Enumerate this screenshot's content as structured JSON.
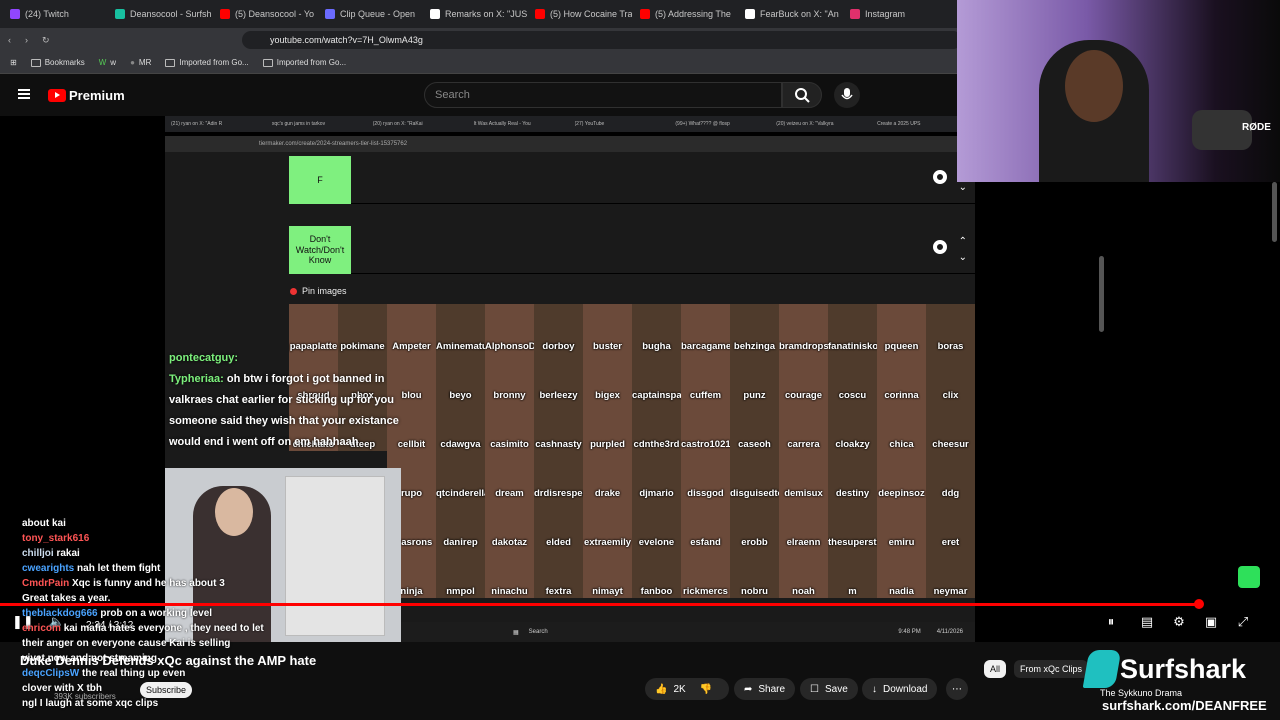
{
  "browser": {
    "tabs": [
      {
        "label": "(24) Twitch",
        "color": "#9146ff"
      },
      {
        "label": "Deansocool - Surfsh",
        "color": "#18c0a0"
      },
      {
        "label": "(5) Deansocool - Yo",
        "color": "#ff0000"
      },
      {
        "label": "Clip Queue - Open",
        "color": "#6b6bff"
      },
      {
        "label": "Remarks on X: \"JUS",
        "color": "#ffffff"
      },
      {
        "label": "(5) How Cocaine Tra",
        "color": "#ff0000"
      },
      {
        "label": "(5) Addressing The",
        "color": "#ff0000"
      },
      {
        "label": "FearBuck on X: \"An",
        "color": "#ffffff"
      },
      {
        "label": "Instagram",
        "color": "#e1306c"
      }
    ],
    "url": "youtube.com/watch?v=7H_OlwmA43g",
    "bookmarks": [
      "Bookmarks",
      "w",
      "MR",
      "Imported from Go...",
      "Imported from Go..."
    ]
  },
  "youtube": {
    "brand": "Premium",
    "search_placeholder": "Search"
  },
  "inner": {
    "tabs": [
      "(21) ryan on X: \"Adin R",
      "xqc's gun jams in tarkov",
      "(20) ryan on X: \"RaKai",
      "It Was Actually Real - You",
      "(27) YouTube",
      "(99+) What???? @ flosp",
      "(20) veizeu on X: \"Valkyra",
      "Create a 2025 UPS"
    ],
    "url": "tiermaker.com/create/2024-streamers-tier-list-15375762",
    "tiers": [
      "F",
      "Don't Watch/Don't Know"
    ],
    "pin_label": "Pin images"
  },
  "streamers": [
    "papaplatte",
    "pokimane",
    "Ampeter",
    "Aminematue",
    "AlphonsoDavies",
    "dorboy",
    "buster",
    "bugha",
    "barcagamer",
    "behzinga",
    "bramdropsmoff",
    "fanatiniskoff",
    "pqueen",
    "boras",
    "shroud",
    "pbox",
    "blou",
    "beyo",
    "bronny",
    "berleezy",
    "bigex",
    "captainsparklez",
    "cuffem",
    "punz",
    "courage",
    "coscu",
    "corinna",
    "clix",
    "chichaito",
    "dteep",
    "cellbit",
    "cdawgva",
    "casimito",
    "cashnasty",
    "purpled",
    "cdnthe3rd",
    "castro1021",
    "caseoh",
    "carrera",
    "cloakzy",
    "chica",
    "cheesur",
    "",
    "",
    "rupo",
    "qtcinderella",
    "dream",
    "drdisrespect",
    "drake",
    "djmario",
    "dissgod",
    "disguisedtoast",
    "demisux",
    "destiny",
    "deepinsoz",
    "ddg",
    "",
    "",
    "syasrons",
    "danirep",
    "dakotaz",
    "elded",
    "extraemily",
    "evelone",
    "esfand",
    "erobb",
    "elraenn",
    "thesuperstering",
    "emiru",
    "eret",
    "",
    "",
    "ninja",
    "nmpol",
    "ninachu",
    "fextra",
    "nimayt",
    "fanboo",
    "rickmercs",
    "nobru",
    "noah",
    "m",
    "nadia",
    "neymar"
  ],
  "chat_overlay": [
    {
      "user": "pontecatguy:",
      "text": ""
    },
    {
      "user": "Typheriaa:",
      "text": "oh btw i forgot i got banned in valkraes chat earlier for sticking up for you someone said they wish that your existance would end i went off on em hahhaah"
    }
  ],
  "chat_bottom": [
    {
      "user": "",
      "text": "about kai"
    },
    {
      "user": "tony_stark616",
      "text": ""
    },
    {
      "user": "chilljoi",
      "text": "rakai"
    },
    {
      "user": "cwearights",
      "text": "nah let them fight"
    },
    {
      "user": "CmdrPain",
      "text": "Xqc is funny and he has about 3"
    },
    {
      "user": "",
      "text": "Great takes a year."
    },
    {
      "user": "theblackdog666",
      "text": "prob on a working level"
    },
    {
      "user": "enricom",
      "text": "kai mafia hates everyone , they need to let their anger on everyone cause Kai is selling"
    },
    {
      "user": "",
      "text": "vivet now and not streaming"
    },
    {
      "user": "deqcClipsW",
      "text": "the real thing up even"
    },
    {
      "user": "",
      "text": "clover with X tbh"
    },
    {
      "user": "",
      "text": "ngl I laugh at some xqc clips"
    }
  ],
  "player": {
    "time": "2:34 / 3:12",
    "progress": 0.937
  },
  "video": {
    "title": "Duke Dennis Defends xQc against the AMP hate",
    "subscribe_label": "Subscribe",
    "subscribers": "393K subscribers",
    "likes": "2K",
    "share": "Share",
    "save": "Save",
    "download": "Download",
    "filter_all": "All",
    "filter_from": "From xQc Clips"
  },
  "sponsor": {
    "name": "Surfshark",
    "subtitle": "The Sykkuno Drama",
    "url": "surfshark.com/DEANFREE"
  },
  "webcam": {
    "mic_brand": "RØDE"
  },
  "taskbar": {
    "search": "Search",
    "clock": "9:48 PM",
    "date": "4/11/2026"
  }
}
